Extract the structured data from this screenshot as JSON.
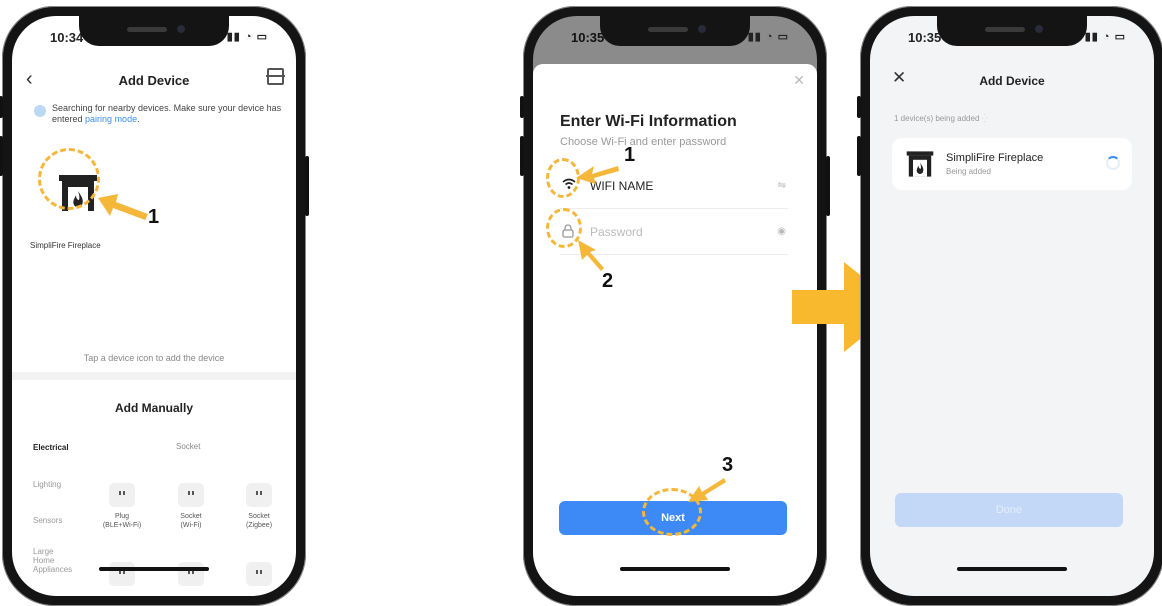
{
  "colors": {
    "annotation": "#f5b73a",
    "primary": "#3d8af7",
    "link": "#3a8ef0"
  },
  "screen1": {
    "time": "10:34",
    "title": "Add Device",
    "search_text": "Searching for nearby devices. Make sure your device has entered",
    "search_link": "pairing mode",
    "search_end": ".",
    "device_label": "SimpliFire Fireplace",
    "tap_hint": "Tap a device icon to add the device",
    "manual_title": "Add Manually",
    "categories": [
      "Electrical",
      "Lighting",
      "Sensors",
      "Large Home Appliances"
    ],
    "subheader": "Socket",
    "tiles": [
      {
        "label_1": "Plug",
        "label_2": "(BLE+Wi-Fi)"
      },
      {
        "label_1": "Socket",
        "label_2": "(Wi-Fi)"
      },
      {
        "label_1": "Socket",
        "label_2": "(Zigbee)"
      }
    ]
  },
  "screen2": {
    "time": "10:35",
    "title": "Enter Wi-Fi Information",
    "subtitle": "Choose Wi-Fi and enter password",
    "wifi_name": "WIFI NAME",
    "password_placeholder": "Password",
    "next_label": "Next"
  },
  "screen3": {
    "time": "10:35",
    "title": "Add Device",
    "adding_text": "1 device(s) being added",
    "device_name": "SimpliFire Fireplace",
    "device_status": "Being added",
    "done_label": "Done"
  },
  "annotations": {
    "n1_a": "1",
    "n1_b": "1",
    "n2": "2",
    "n3": "3"
  }
}
